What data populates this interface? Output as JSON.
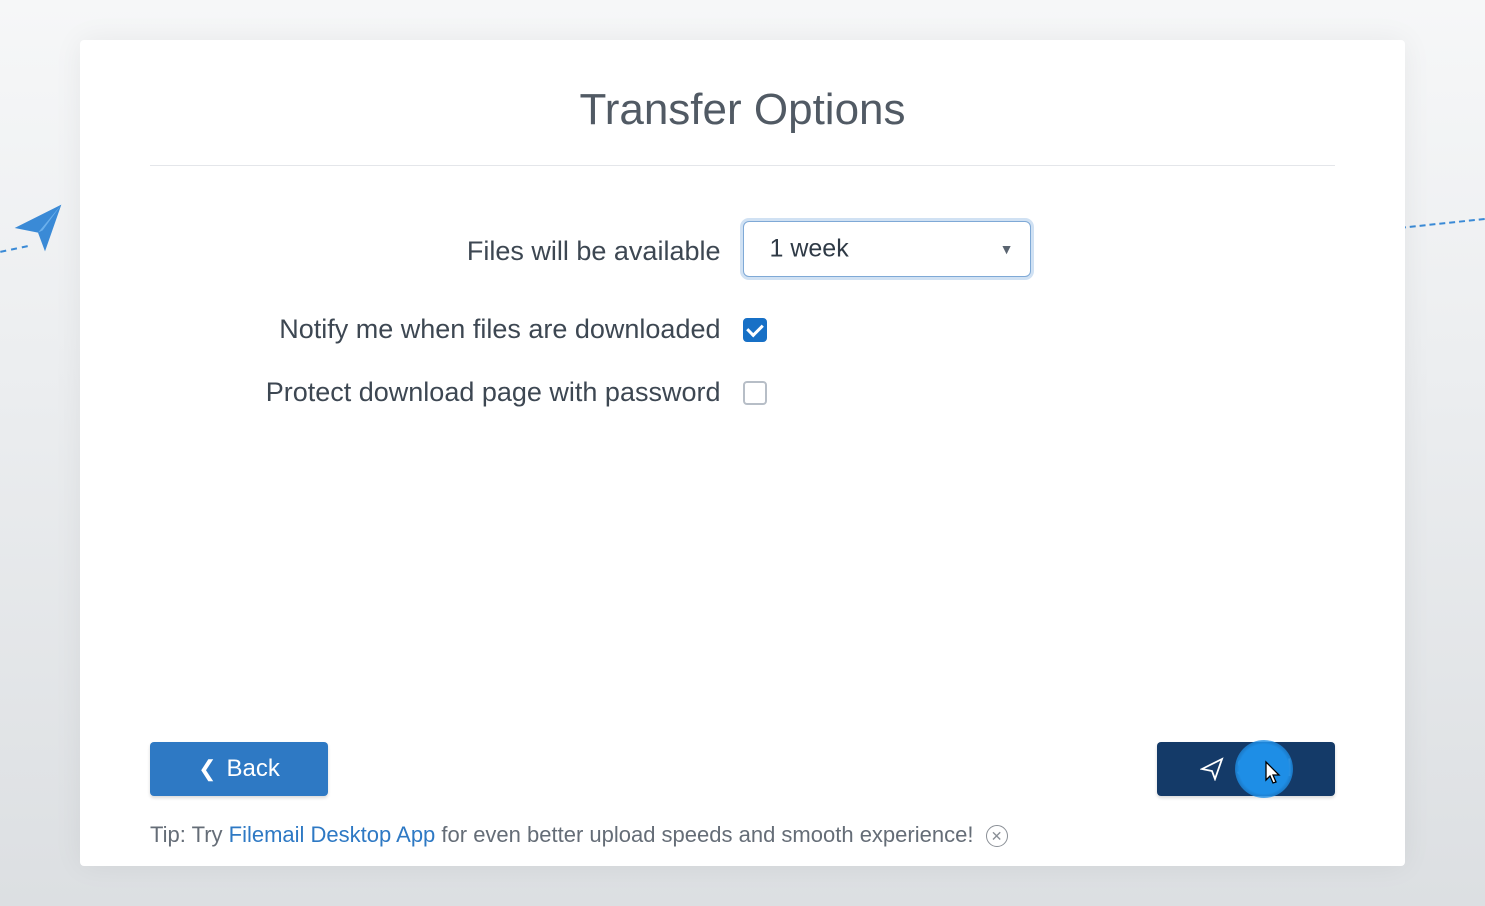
{
  "title": "Transfer Options",
  "form": {
    "availability_label": "Files will be available",
    "availability_value": "1 week",
    "notify_label": "Notify me when files are downloaded",
    "notify_checked": true,
    "password_label": "Protect download page with password",
    "password_checked": false
  },
  "buttons": {
    "back": "Back",
    "send": "Send"
  },
  "tip": {
    "prefix": "Tip: Try ",
    "link_text": "Filemail Desktop App",
    "suffix": " for even better upload speeds and smooth experience!"
  }
}
